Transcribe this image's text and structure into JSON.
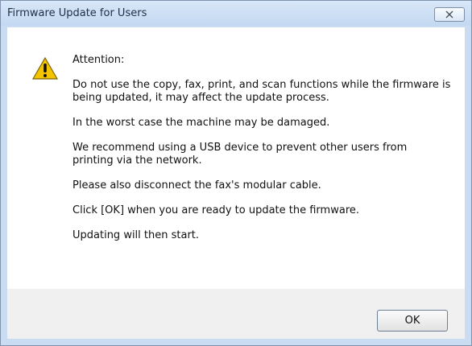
{
  "window": {
    "title": "Firmware Update for Users"
  },
  "dialog": {
    "icon": "warning-icon",
    "heading": "Attention:",
    "paragraphs": [
      "Do not use the copy, fax, print, and scan functions while the firmware is being updated, it may affect the update process.",
      "In the worst case the machine may be damaged.",
      "We recommend using a USB device to prevent other users from printing via the network.",
      "Please also disconnect the fax's modular cable.",
      "Click [OK] when you are ready to update the firmware.",
      "Updating will then start."
    ]
  },
  "buttons": {
    "ok": "OK",
    "close_icon": "close-icon"
  },
  "colors": {
    "titlebar": "#c9dcf2",
    "warning_fill": "#f5c400"
  }
}
